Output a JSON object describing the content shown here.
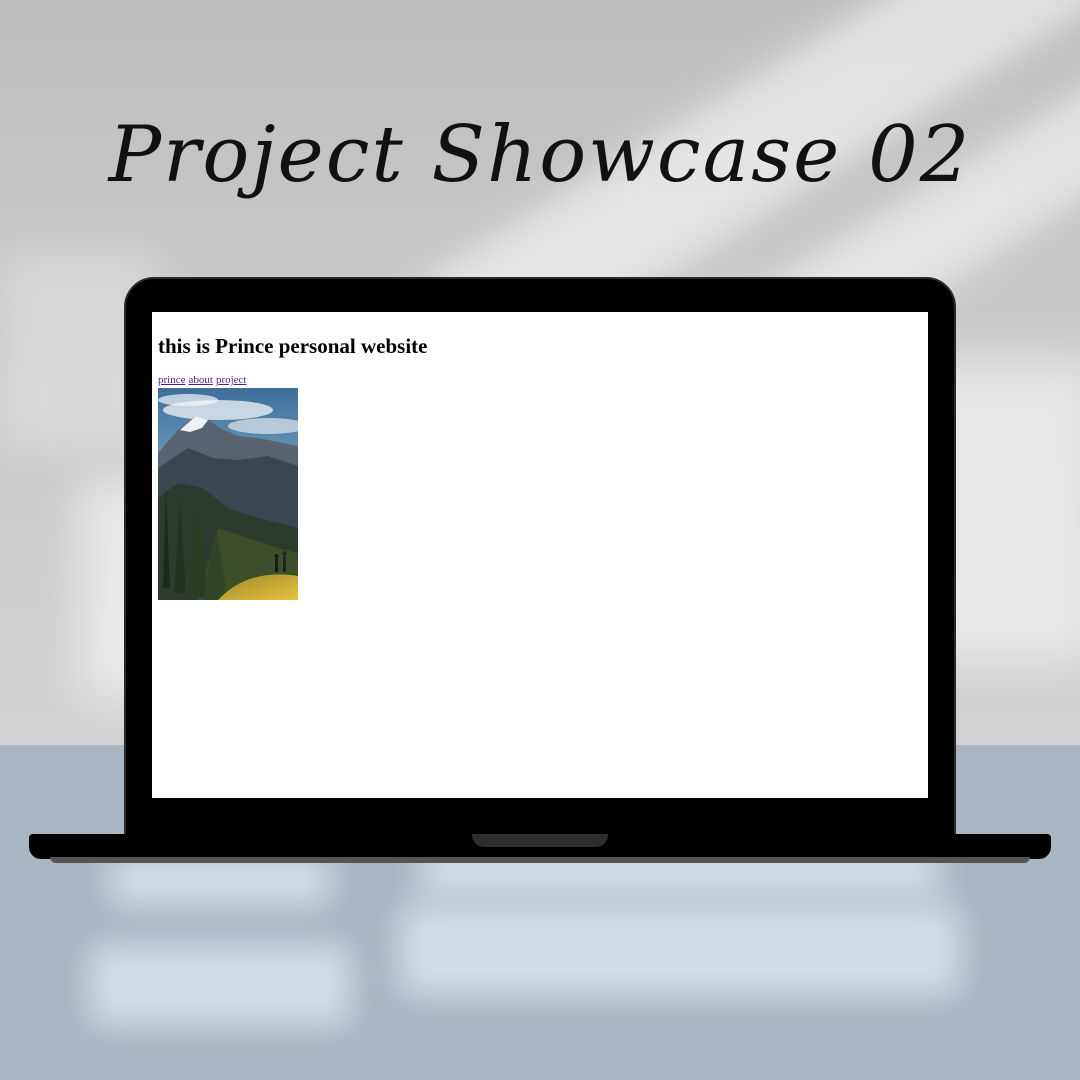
{
  "showcase": {
    "title": "Project Showcase 02"
  },
  "website": {
    "heading": "this is Prince personal website",
    "nav": [
      {
        "label": "prince"
      },
      {
        "label": "about"
      },
      {
        "label": "project"
      }
    ],
    "photo": {
      "icon": "mountain-landscape-photo"
    },
    "link_color": "#551a8b"
  },
  "colors": {
    "wall": "#c8c8c8",
    "floor": "#a9b6c1",
    "laptop": "#000000",
    "screen": "#ffffff"
  }
}
